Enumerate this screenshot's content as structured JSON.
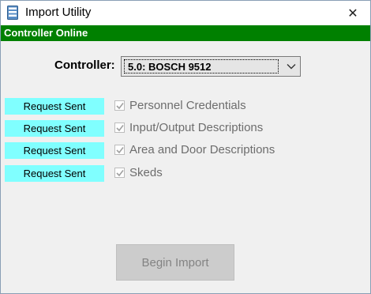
{
  "window": {
    "title": "Import Utility",
    "close_label": "✕"
  },
  "status": {
    "text": "Controller Online",
    "color": "#008000"
  },
  "controller": {
    "label": "Controller:",
    "selected": "5.0: BOSCH 9512"
  },
  "items": [
    {
      "status": "Request Sent",
      "label": "Personnel Credentials",
      "checked": true
    },
    {
      "status": "Request Sent",
      "label": "Input/Output Descriptions",
      "checked": true
    },
    {
      "status": "Request Sent",
      "label": "Area and Door Descriptions",
      "checked": true
    },
    {
      "status": "Request Sent",
      "label": "Skeds",
      "checked": true
    }
  ],
  "footer": {
    "begin_label": "Begin Import"
  },
  "colors": {
    "status_bg": "#80ffff",
    "online": "#008000"
  },
  "icons": {
    "app": "database-icon",
    "close": "close-icon",
    "dropdown": "chevron-down-icon",
    "check": "checkmark-icon"
  }
}
